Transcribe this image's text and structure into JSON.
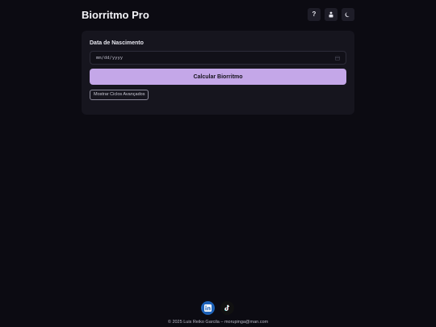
{
  "app": {
    "title": "Biorritmo Pro"
  },
  "header": {
    "help_label": "?",
    "icons": [
      "help-icon",
      "person-icon",
      "moon-icon"
    ]
  },
  "form": {
    "birth_date_label": "Data de Nascimento",
    "birth_date_placeholder": "mm/dd/yyyy",
    "calculate_label": "Calcular Biorritmo",
    "advanced_label": "Mostrar Ciclos Avançados"
  },
  "social": {
    "linkedin_label": "in",
    "tiktok_label": "♪",
    "colors": {
      "linkedin": "#1e62b8",
      "tiktok": "#111111"
    }
  },
  "footer": {
    "text": "© 2025 Luis Reiko Garcila – moruping​a@man.com"
  },
  "colors": {
    "background": "#0c0b12",
    "card": "#16151e",
    "accent": "#c4a7e8"
  }
}
